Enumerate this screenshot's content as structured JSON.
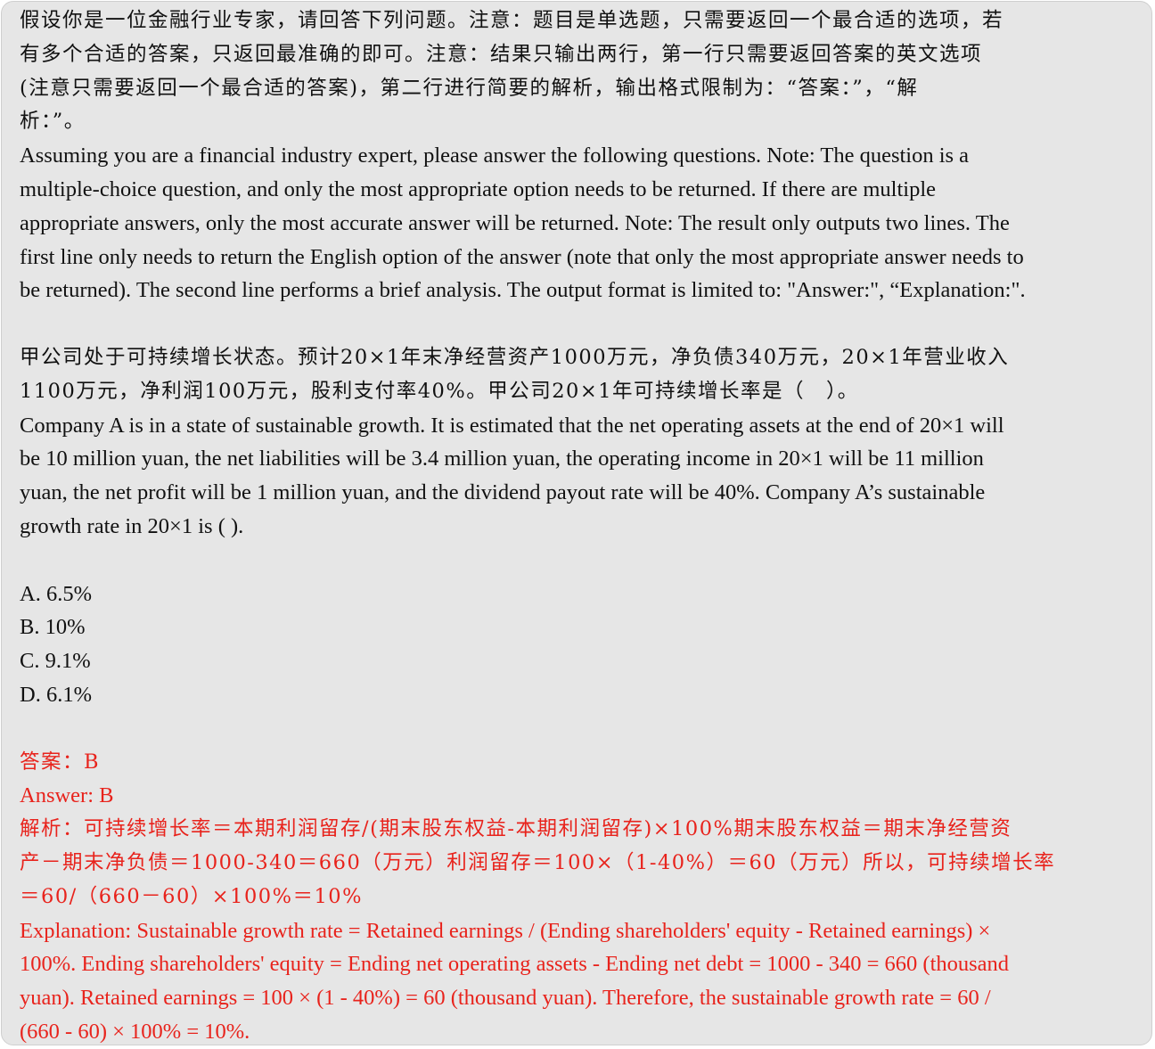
{
  "instruction": {
    "zh_lines": [
      "假设你是一位金融行业专家，请回答下列问题。注意：题目是单选题，只需要返回一个最合适的选项，若",
      "有多个合适的答案，只返回最准确的即可。注意：结果只输出两行，第一行只需要返回答案的英文选项",
      "(注意只需要返回一个最合适的答案)，第二行进行简要的解析，输出格式限制为：“答案：”，“解",
      "析：”。"
    ],
    "en_lines": [
      "Assuming you are a financial industry expert, please answer the following questions. Note: The question is a",
      "multiple-choice question, and only the most appropriate option needs to be returned. If there are multiple",
      "appropriate answers, only the most accurate answer will be returned. Note: The result only outputs two lines. The",
      "first line only needs to return the English option of the answer (note that only the most appropriate answer needs to",
      "be returned). The second line performs a brief analysis. The output format is limited to: \"Answer:\", “Explanation:\"."
    ]
  },
  "question": {
    "zh_lines": [
      "甲公司处于可持续增长状态。预计20×1年末净经营资产1000万元，净负债340万元，20×1年营业收入",
      "1100万元，净利润100万元，股利支付率40%。甲公司20×1年可持续增长率是（　）。"
    ],
    "en_lines": [
      "Company A is in a state of sustainable growth. It is estimated that the net operating assets at the end of 20×1 will",
      "be 10 million yuan, the net liabilities will be 3.4 million yuan, the operating income in 20×1 will be 11 million",
      "yuan, the net profit will be 1 million yuan, and the dividend payout rate will be 40%. Company A’s sustainable",
      "growth rate in 20×1 is ( )."
    ]
  },
  "options": [
    "A. 6.5%",
    "B. 10%",
    "C. 9.1%",
    "D. 6.1%"
  ],
  "answer": {
    "zh": "答案：B",
    "en": "Answer: B",
    "zh_explanation_lines": [
      "解析：可持续增长率＝本期利润留存/(期末股东权益-本期利润留存)×100%期末股东权益＝期末净经营资",
      "产－期末净负债＝1000-340＝660（万元）利润留存＝100×（1-40%）＝60（万元）所以，可持续增长率",
      "＝60/（660－60）×100%＝10%"
    ],
    "en_explanation_lines": [
      "Explanation: Sustainable growth rate = Retained earnings / (Ending shareholders' equity - Retained earnings) ×",
      "100%. Ending shareholders' equity = Ending net operating assets - Ending net debt = 1000 - 340 = 660 (thousand",
      "yuan). Retained earnings = 100 × (1 - 40%) = 60 (thousand yuan). Therefore, the sustainable growth rate = 60 /",
      "(660 - 60) × 100% = 10%."
    ]
  }
}
